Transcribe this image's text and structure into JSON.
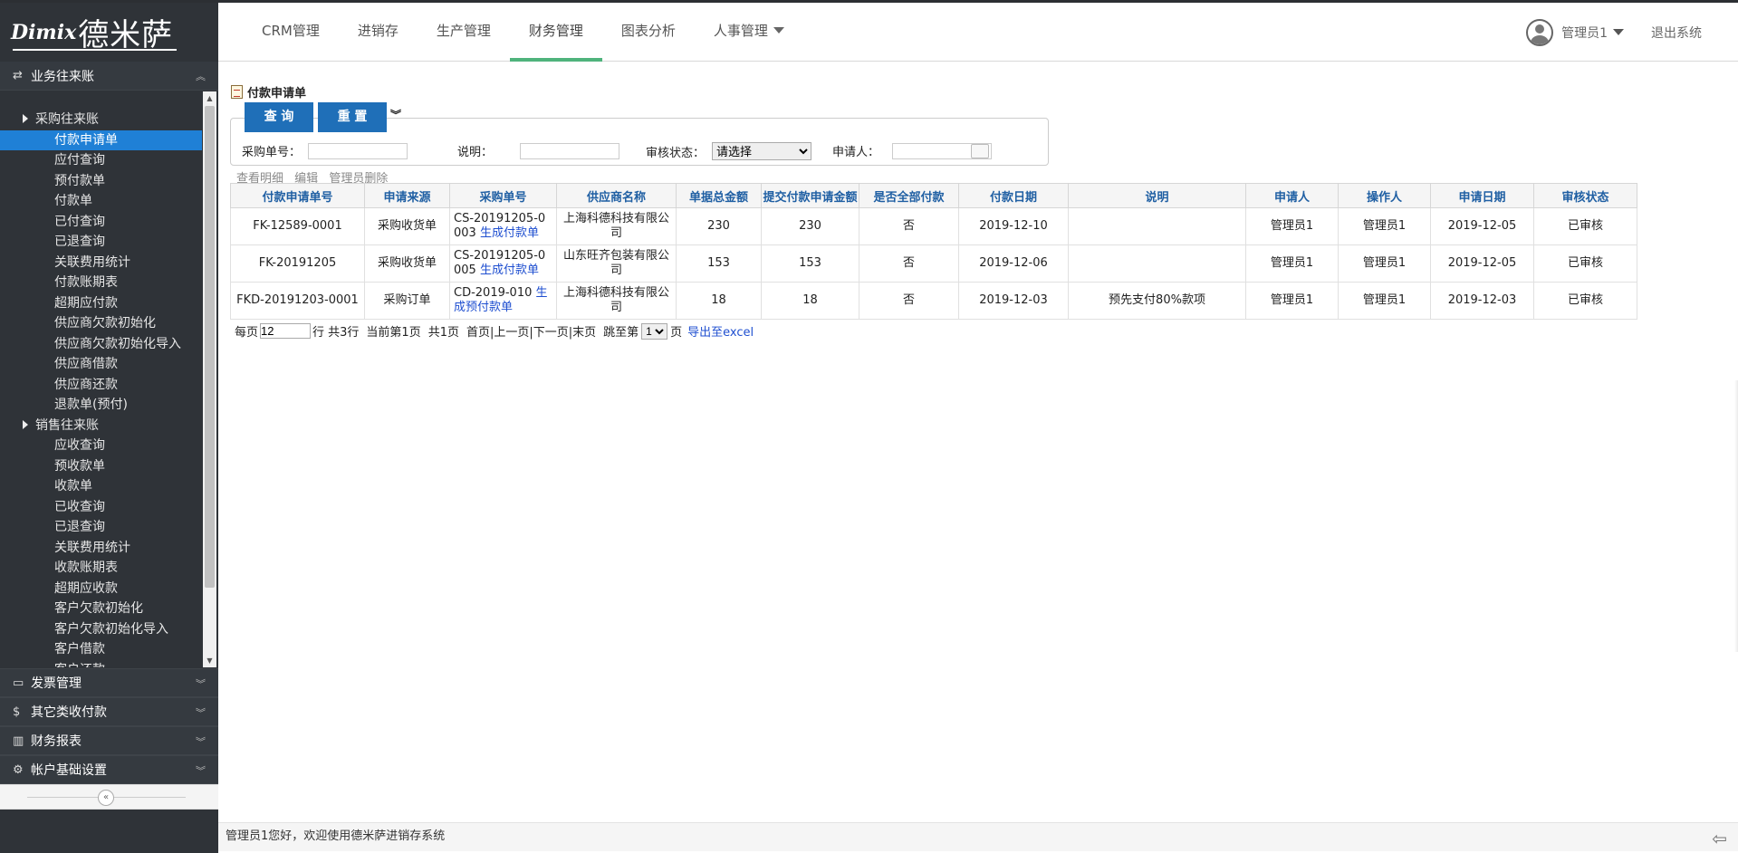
{
  "logo": {
    "en": "Dimix",
    "cn": "德米萨"
  },
  "nav": [
    {
      "label": "CRM管理",
      "active": false
    },
    {
      "label": "进销存",
      "active": false
    },
    {
      "label": "生产管理",
      "active": false
    },
    {
      "label": "财务管理",
      "active": true
    },
    {
      "label": "图表分析",
      "active": false
    },
    {
      "label": "人事管理",
      "active": false
    }
  ],
  "user": {
    "name": "管理员1",
    "logout": "退出系统"
  },
  "sidebar": {
    "top_section": "业务往来账",
    "groups": [
      {
        "label": "采购往来账",
        "items": [
          "付款申请单",
          "应付查询",
          "预付款单",
          "付款单",
          "已付查询",
          "已退查询",
          "关联费用统计",
          "付款账期表",
          "超期应付款",
          "供应商欠款初始化",
          "供应商欠款初始化导入",
          "供应商借款",
          "供应商还款",
          "退款单(预付)"
        ]
      },
      {
        "label": "销售往来账",
        "items": [
          "应收查询",
          "预收款单",
          "收款单",
          "已收查询",
          "已退查询",
          "关联费用统计",
          "收款账期表",
          "超期应收款",
          "客户欠款初始化",
          "客户欠款初始化导入",
          "客户借款",
          "客户还款"
        ]
      }
    ],
    "active_item": "付款申请单",
    "lower_sections": [
      {
        "label": "发票管理",
        "icon": "card-icon"
      },
      {
        "label": "其它类收付款",
        "icon": "dollar-icon"
      },
      {
        "label": "财务报表",
        "icon": "bar-chart-icon"
      },
      {
        "label": "帐户基础设置",
        "icon": "gear-icon"
      }
    ]
  },
  "page": {
    "title": "付款申请单",
    "query_button": "查 询",
    "reset_button": "重 置",
    "fields": {
      "purchase_no_label": "采购单号：",
      "desc_label": "说明：",
      "status_label": "审核状态：",
      "status_value": "请选择",
      "applicant_label": "申请人："
    },
    "actions": [
      "查看明细",
      "编辑",
      "管理员删除"
    ]
  },
  "table": {
    "columns": [
      "付款申请单号",
      "申请来源",
      "采购单号",
      "供应商名称",
      "单据总金额",
      "提交付款申请金额",
      "是否全部付款",
      "付款日期",
      "说明",
      "申请人",
      "操作人",
      "申请日期",
      "审核状态"
    ],
    "rows": [
      {
        "no": "FK-12589-0001",
        "source": "采购收货单",
        "po": "CS-20191205-0003",
        "po_link": "生成付款单",
        "supplier": "上海科德科技有限公司",
        "total": "230",
        "apply_amount": "230",
        "all_paid": "否",
        "pay_date": "2019-12-10",
        "desc": "",
        "applicant": "管理员1",
        "operator": "管理员1",
        "apply_date": "2019-12-05",
        "status": "已审核"
      },
      {
        "no": "FK-20191205",
        "source": "采购收货单",
        "po": "CS-20191205-0005",
        "po_link": "生成付款单",
        "supplier": "山东旺齐包装有限公司",
        "total": "153",
        "apply_amount": "153",
        "all_paid": "否",
        "pay_date": "2019-12-06",
        "desc": "",
        "applicant": "管理员1",
        "operator": "管理员1",
        "apply_date": "2019-12-05",
        "status": "已审核"
      },
      {
        "no": "FKD-20191203-0001",
        "source": "采购订单",
        "po": "CD-2019-010",
        "po_link": "生成预付款单",
        "supplier": "上海科德科技有限公司",
        "total": "18",
        "apply_amount": "18",
        "all_paid": "否",
        "pay_date": "2019-12-03",
        "desc": "预先支付80%款项",
        "applicant": "管理员1",
        "operator": "管理员1",
        "apply_date": "2019-12-03",
        "status": "已审核"
      }
    ]
  },
  "pager": {
    "per_page_label": "每页",
    "per_page_value": "12",
    "rows_text": "行 共3行",
    "current_text": "当前第1页",
    "total_text": "共1页",
    "nav_text": "首页|上一页|下一页|末页",
    "jump_label": "跳至第",
    "jump_value": "1",
    "page_suffix": "页",
    "export": "导出至excel"
  },
  "footer": {
    "text": "管理员1您好，欢迎使用德米萨进销存系统"
  }
}
